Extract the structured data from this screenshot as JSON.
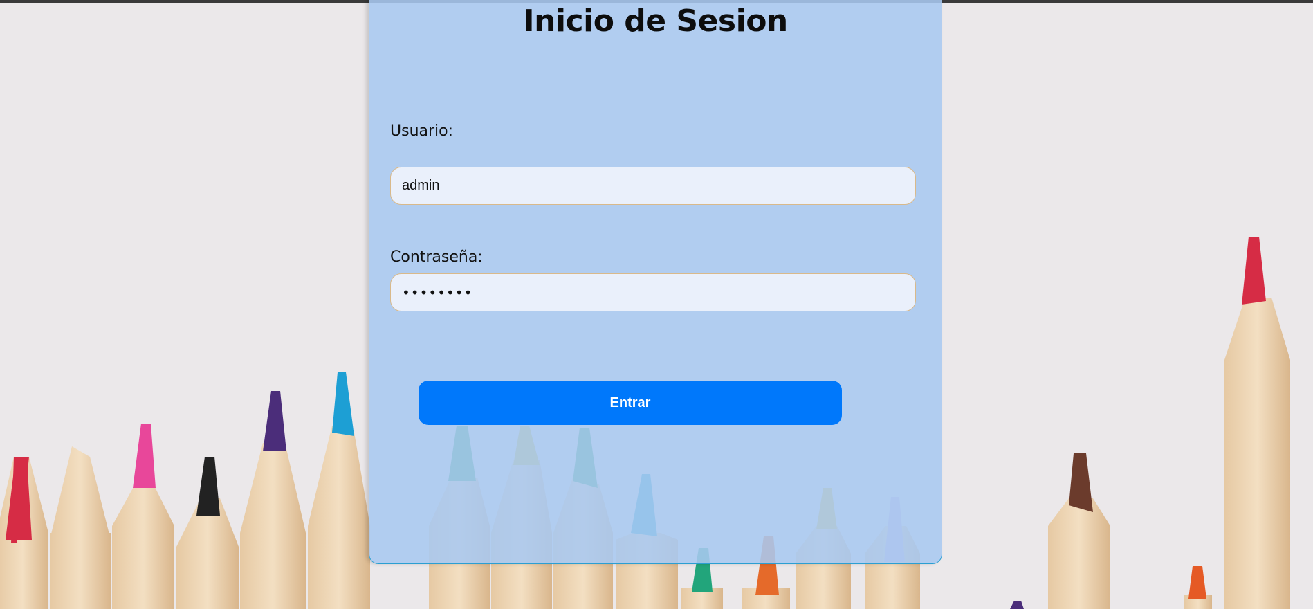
{
  "login": {
    "title": "Inicio de Sesion",
    "user_label": "Usuario:",
    "user_value": "admin",
    "password_label": "Contraseña:",
    "password_value": "12345678",
    "submit_label": "Entrar"
  },
  "colors": {
    "card_bg": "#a8c8f0",
    "card_border": "#2b9fd2",
    "button_bg": "#0078fb",
    "field_bg": "#eaf0fb",
    "field_border": "#d9b98a"
  }
}
